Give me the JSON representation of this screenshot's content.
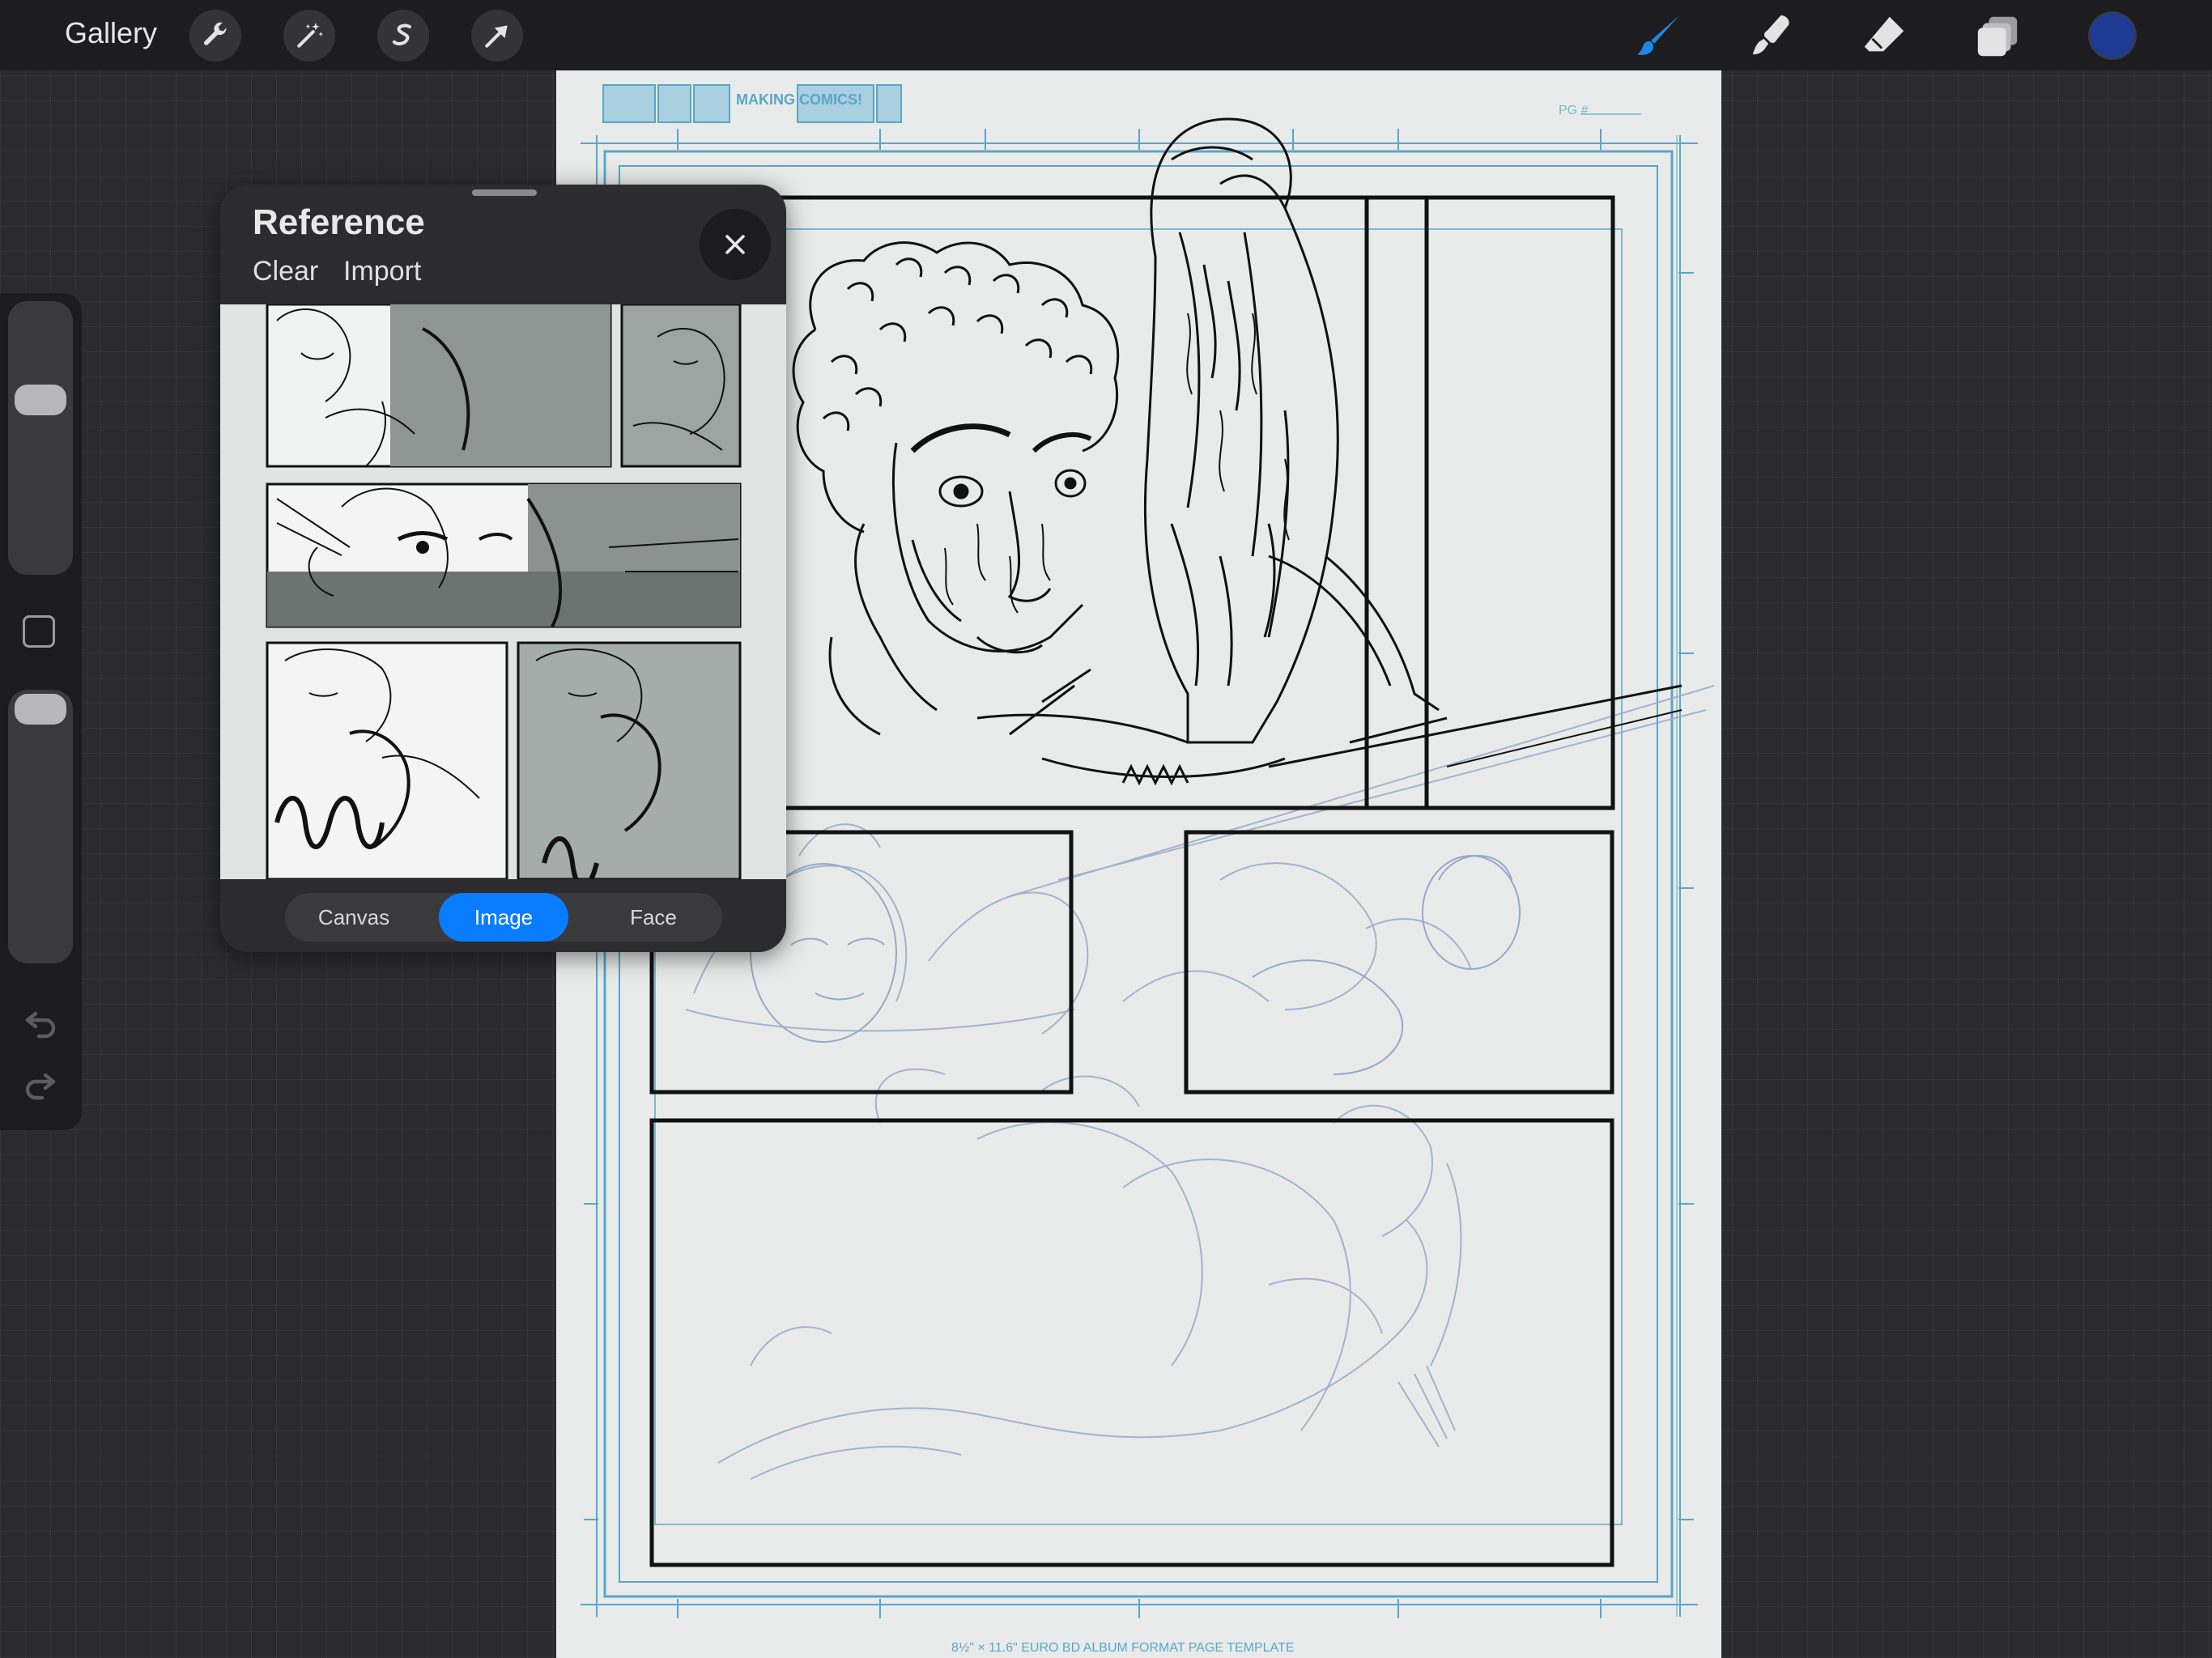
{
  "topbar": {
    "gallery_label": "Gallery",
    "actions": [
      {
        "name": "actions-button",
        "icon": "wrench-icon"
      },
      {
        "name": "adjustments-button",
        "icon": "magic-wand-icon"
      },
      {
        "name": "selection-button",
        "icon": "selection-s-icon"
      },
      {
        "name": "transform-button",
        "icon": "arrow-cursor-icon"
      }
    ],
    "tools": [
      {
        "name": "brush-tool",
        "icon": "brush-icon",
        "active": true
      },
      {
        "name": "smudge-tool",
        "icon": "smudge-icon",
        "active": false
      },
      {
        "name": "eraser-tool",
        "icon": "eraser-icon",
        "active": false
      },
      {
        "name": "layers-button",
        "icon": "layers-icon",
        "active": false
      }
    ],
    "current_color": "#1f3a93",
    "active_tool_color": "#1e88e5"
  },
  "sidebar": {
    "brush_size_level": 0.2,
    "opacity_level": 0.05,
    "modify_button": "square-icon",
    "undo_icon": "undo-icon",
    "redo_icon": "redo-icon"
  },
  "canvas": {
    "template_header": "MAKING COMICS!",
    "page_number_label": "PG #",
    "template_footer": "8½\" × 11.6\" EURO BD ALBUM FORMAT PAGE TEMPLATE",
    "guide_color": "#5aa6c7",
    "sketch_color": "#9aa7c9"
  },
  "reference": {
    "title": "Reference",
    "clear_label": "Clear",
    "import_label": "Import",
    "close_icon": "close-icon",
    "tabs": [
      {
        "label": "Canvas",
        "active": false
      },
      {
        "label": "Image",
        "active": true
      },
      {
        "label": "Face",
        "active": false
      }
    ],
    "accent": "#0a7cff"
  }
}
